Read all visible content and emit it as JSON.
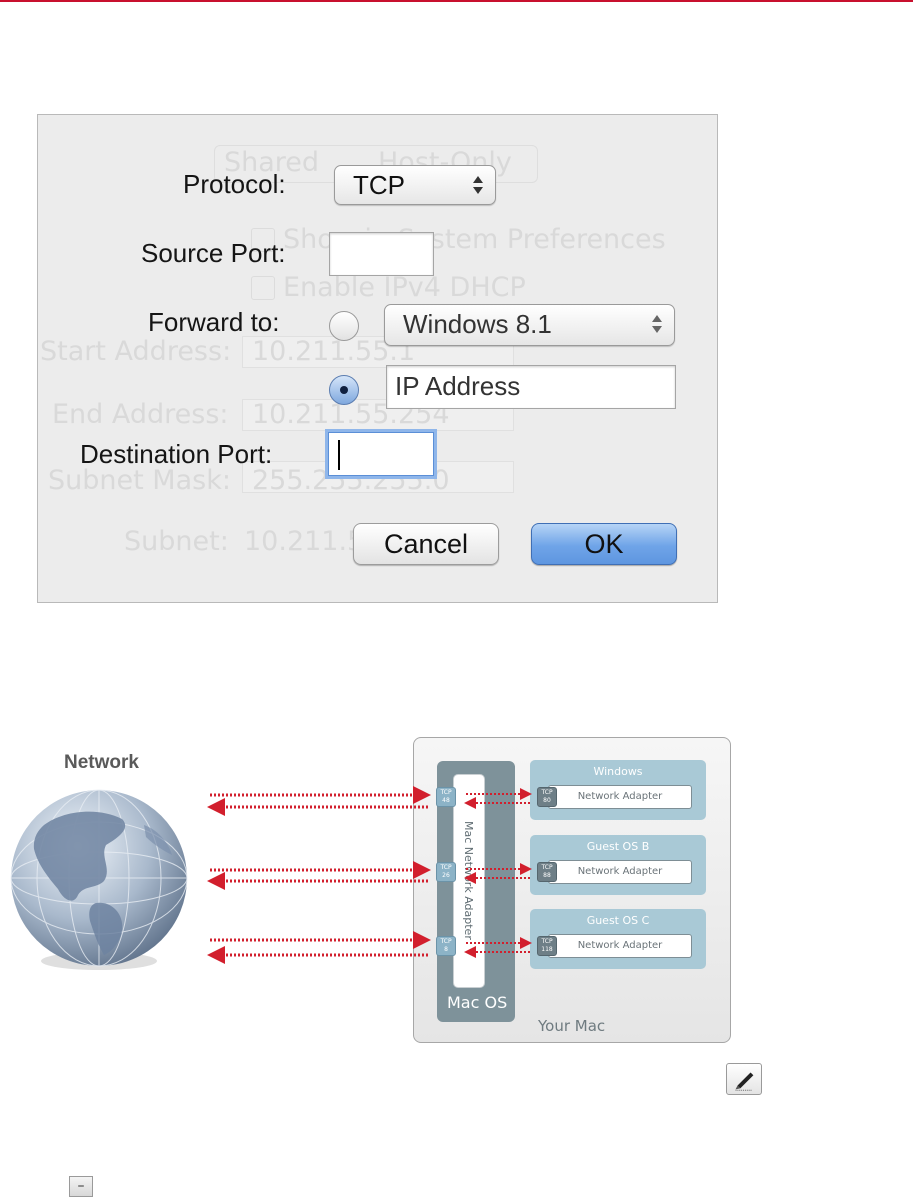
{
  "dialog": {
    "protocol_label": "Protocol:",
    "protocol_value": "TCP",
    "source_port_label": "Source Port:",
    "source_port_value": "",
    "forward_to_label": "Forward to:",
    "forward_vm_value": "Windows 8.1",
    "forward_ip_value": "IP Address",
    "forward_selected": "ip",
    "destination_port_label": "Destination Port:",
    "destination_port_value": "",
    "cancel_label": "Cancel",
    "ok_label": "OK",
    "background": {
      "segment_shared": "Shared",
      "segment_host_only": "Host-Only",
      "show_in_prefs": "Show in System Preferences",
      "enable_dhcp": "Enable IPv4 DHCP",
      "start_address_label": "Start Address:",
      "start_address_value": "10.211.55.1",
      "end_address_label": "End Address:",
      "end_address_value": "10.211.55.254",
      "subnet_mask_label": "Subnet Mask:",
      "subnet_mask_value": "255.255.255.0",
      "subnet_label": "Subnet:",
      "subnet_value": "10.211.55.0"
    }
  },
  "diagram": {
    "network_label": "Network",
    "mac_adapter_label": "Mac Network Adapter",
    "macos_label": "Mac OS",
    "your_mac_label": "Your Mac",
    "guests": [
      {
        "name": "Windows",
        "adapter": "Network Adapter",
        "tcp_label": "TCP",
        "guest_port": "80",
        "host_port": "48"
      },
      {
        "name": "Guest OS B",
        "adapter": "Network Adapter",
        "tcp_label": "TCP",
        "guest_port": "88",
        "host_port": "26"
      },
      {
        "name": "Guest OS C",
        "adapter": "Network Adapter",
        "tcp_label": "TCP",
        "guest_port": "118",
        "host_port": "8"
      }
    ],
    "arrow_color": "#d21f2d"
  },
  "icons": {
    "edit": "pencil-edit-icon",
    "collapse": "minus-collapse-icon",
    "collapse_glyph": "–"
  },
  "colors": {
    "accent_rule": "#c8102e",
    "ok_button": "#6fa4e8",
    "guest_panel": "#a9c9d6",
    "macos_column": "#7e929a"
  }
}
